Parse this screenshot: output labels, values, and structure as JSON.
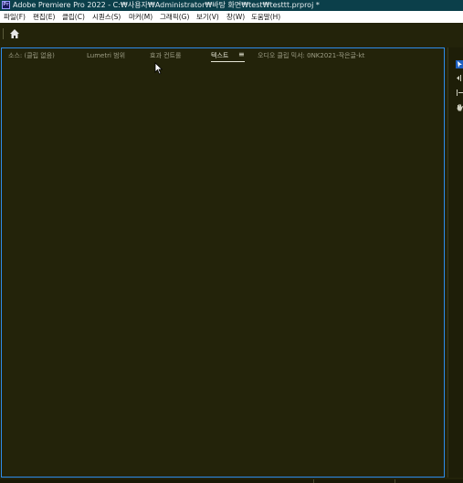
{
  "window": {
    "app_icon_text": "Pr",
    "title": "Adobe Premiere Pro 2022 - C:₩사용자₩Administrator₩바탕 화면₩test₩testtt.prproj *"
  },
  "menu": [
    {
      "label": "파일(F)"
    },
    {
      "label": "편집(E)"
    },
    {
      "label": "클립(C)"
    },
    {
      "label": "시퀀스(S)"
    },
    {
      "label": "마커(M)"
    },
    {
      "label": "그래픽(G)"
    },
    {
      "label": "보기(V)"
    },
    {
      "label": "창(W)"
    },
    {
      "label": "도움말(H)"
    }
  ],
  "panel": {
    "tabs": [
      {
        "label": "소스: (클립 없음)"
      },
      {
        "label": "Lumetri 범위"
      },
      {
        "label": "효과 컨트롤"
      },
      {
        "label": "텍스트"
      },
      {
        "label": "오디오 클립 믹서: 0NK2021-작은글-kt"
      }
    ],
    "active_tab": "텍스트",
    "tab_menu_glyph": "≡"
  },
  "colors": {
    "titlebar": "#0b3f4a",
    "background": "#23230a",
    "panel_focus_border": "#2d8ceb",
    "tab_inactive": "#9d9d85",
    "tab_active": "#e6e6d6"
  },
  "tools": [
    {
      "icon": "selection-tool-icon"
    },
    {
      "icon": "track-select-icon"
    },
    {
      "icon": "ripple-edit-icon"
    },
    {
      "icon": "hand-tool-icon"
    }
  ]
}
